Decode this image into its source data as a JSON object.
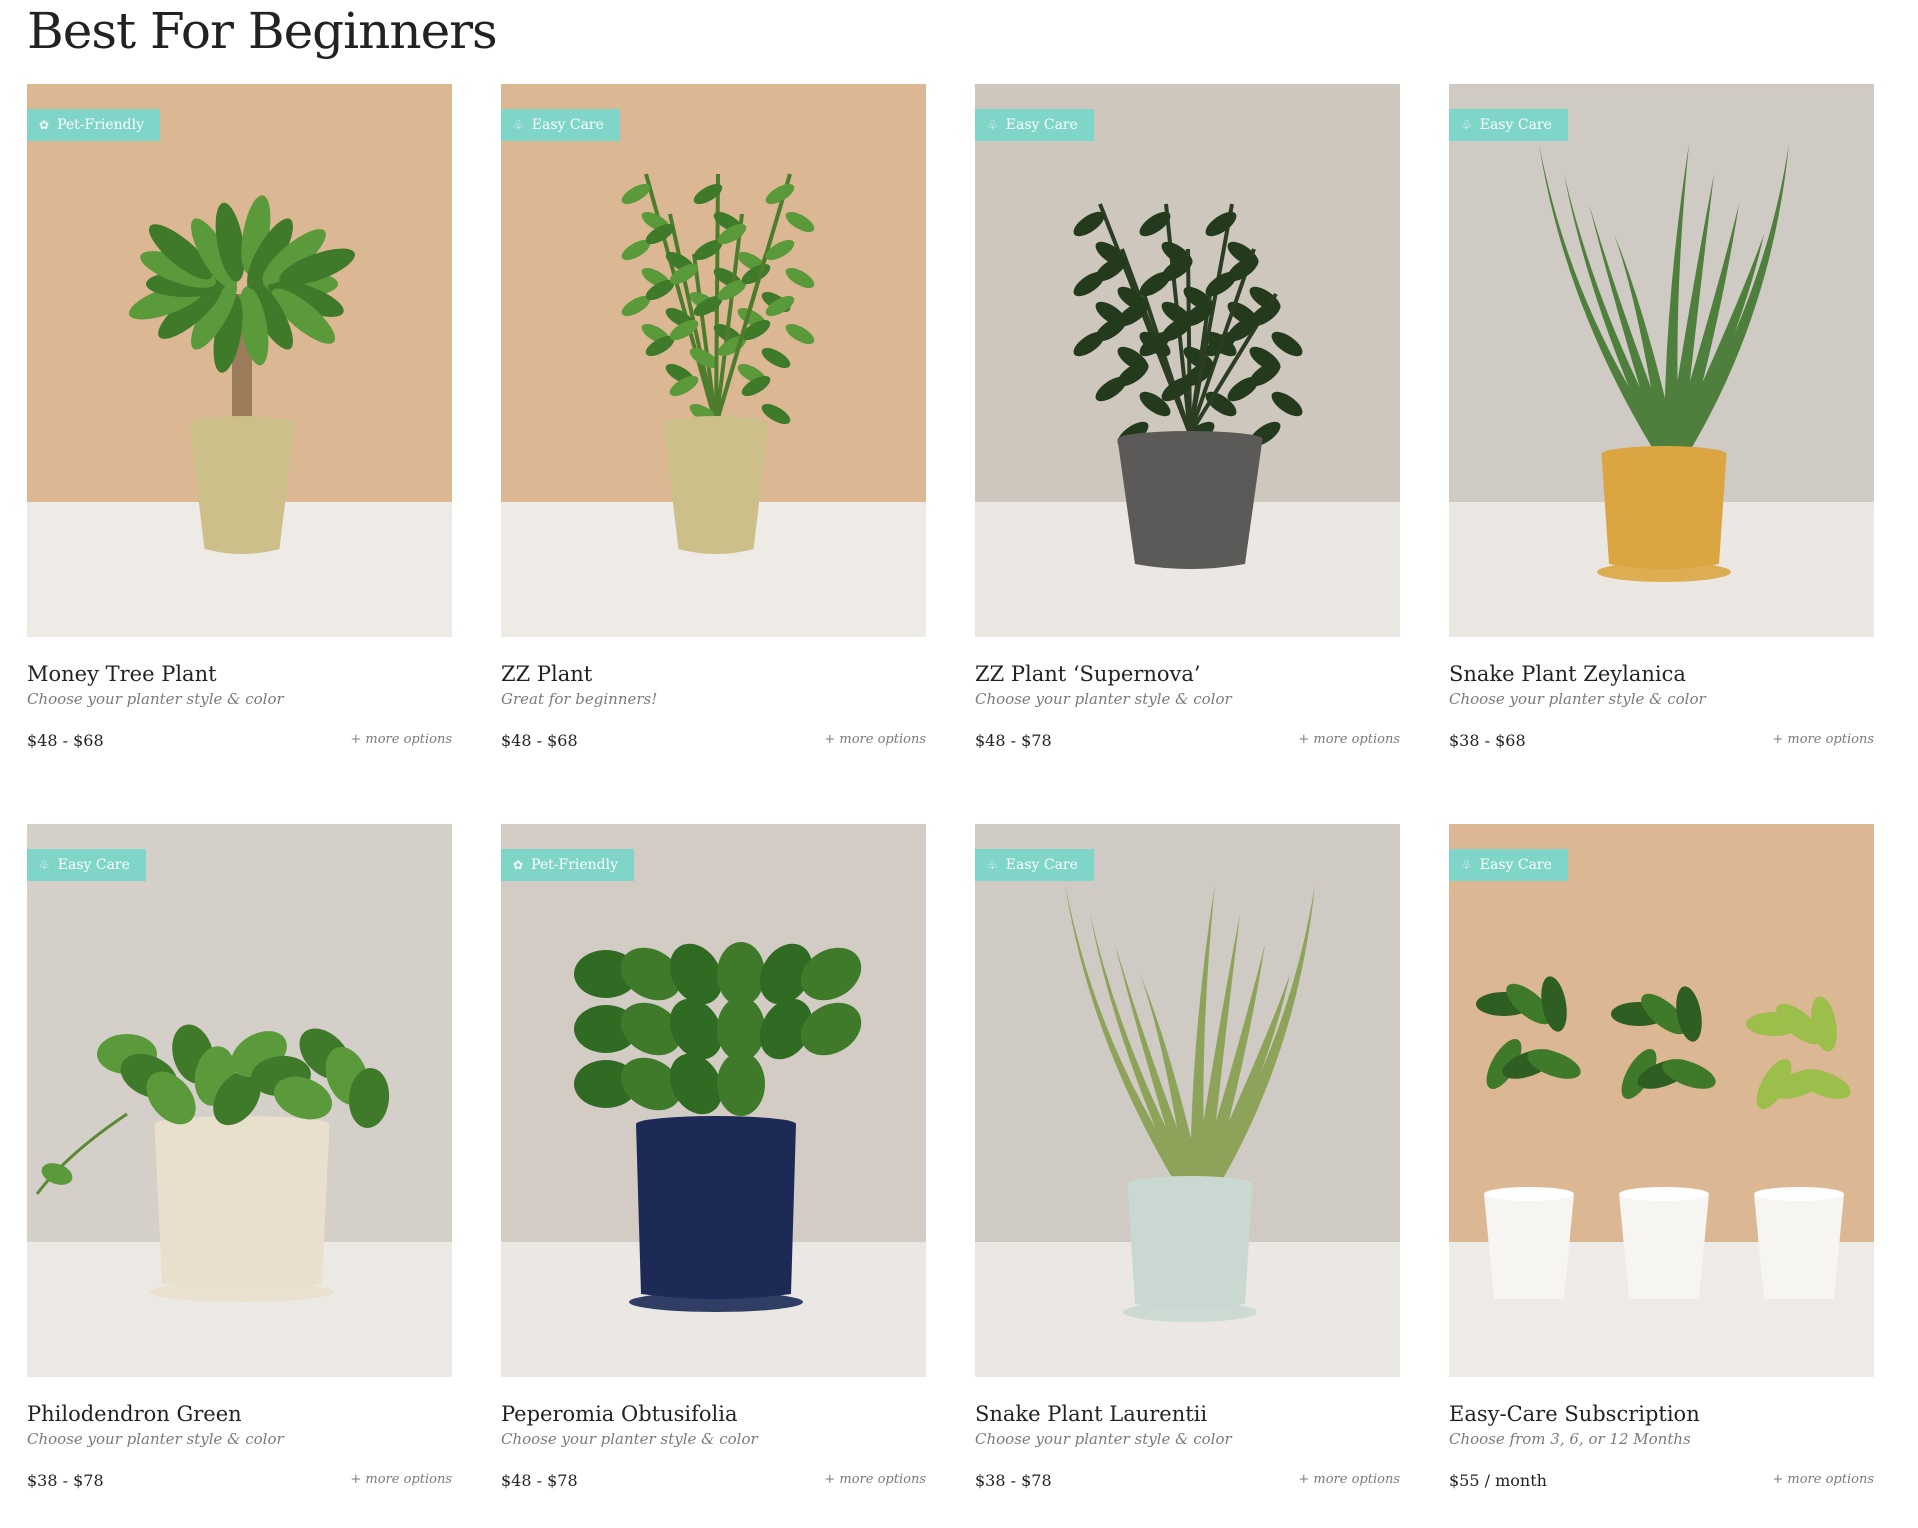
{
  "section": {
    "title": "Best For Beginners"
  },
  "products": [
    {
      "badge": "Pet-Friendly",
      "badge_icon": "paw-icon",
      "name": "Money Tree Plant",
      "subtitle": "Choose your planter style & color",
      "price": "$48 - $68",
      "more": "+ more options",
      "bg": "#dcb793",
      "floor": "#eeeae5",
      "pot": "#cdbf8a",
      "plant": "money-tree"
    },
    {
      "badge": "Easy Care",
      "badge_icon": "thumbs-up-icon",
      "name": "ZZ Plant",
      "subtitle": "Great for beginners!",
      "price": "$48 - $68",
      "more": "+ more options",
      "bg": "#dcb793",
      "floor": "#eeeae5",
      "pot": "#cdbf8a",
      "plant": "zz"
    },
    {
      "badge": "Easy Care",
      "badge_icon": "thumbs-up-icon",
      "name": "ZZ Plant ‘Supernova’",
      "subtitle": "Choose your planter style & color",
      "price": "$48 - $78",
      "more": "+ more options",
      "bg": "#cdc7be",
      "floor": "#ebe8e4",
      "pot": "#5b5a58",
      "plant": "zz-dark"
    },
    {
      "badge": "Easy Care",
      "badge_icon": "thumbs-up-icon",
      "name": "Snake Plant Zeylanica",
      "subtitle": "Choose your planter style & color",
      "price": "$38 - $68",
      "more": "+ more options",
      "bg": "#cfcac3",
      "floor": "#ebe8e4",
      "pot": "#dba641",
      "plant": "snake"
    },
    {
      "badge": "Easy Care",
      "badge_icon": "thumbs-up-icon",
      "name": "Philodendron Green",
      "subtitle": "Choose your planter style & color",
      "price": "$38 - $78",
      "more": "+ more options",
      "bg": "#d4cfc9",
      "floor": "#ece9e5",
      "pot": "#e9dfcd",
      "plant": "philodendron"
    },
    {
      "badge": "Pet-Friendly",
      "badge_icon": "paw-icon",
      "name": "Peperomia Obtusifolia",
      "subtitle": "Choose your planter style & color",
      "price": "$48 - $78",
      "more": "+ more options",
      "bg": "#d2ccc4",
      "floor": "#ebe8e4",
      "pot": "#1c2a55",
      "plant": "peperomia"
    },
    {
      "badge": "Easy Care",
      "badge_icon": "thumbs-up-icon",
      "name": "Snake Plant Laurentii",
      "subtitle": "Choose your planter style & color",
      "price": "$38 - $78",
      "more": "+ more options",
      "bg": "#cfcac3",
      "floor": "#ebe8e4",
      "pot": "#c9d8d0",
      "plant": "snake-light"
    },
    {
      "badge": "Easy Care",
      "badge_icon": "thumbs-up-icon",
      "name": "Easy-Care Subscription",
      "subtitle": "Choose from 3, 6, or 12 Months",
      "price": "$55 / month",
      "more": "+ more options",
      "bg": "#dcb793",
      "floor": "#eeeae5",
      "pot": "#f7f5f1",
      "plant": "trio"
    }
  ]
}
